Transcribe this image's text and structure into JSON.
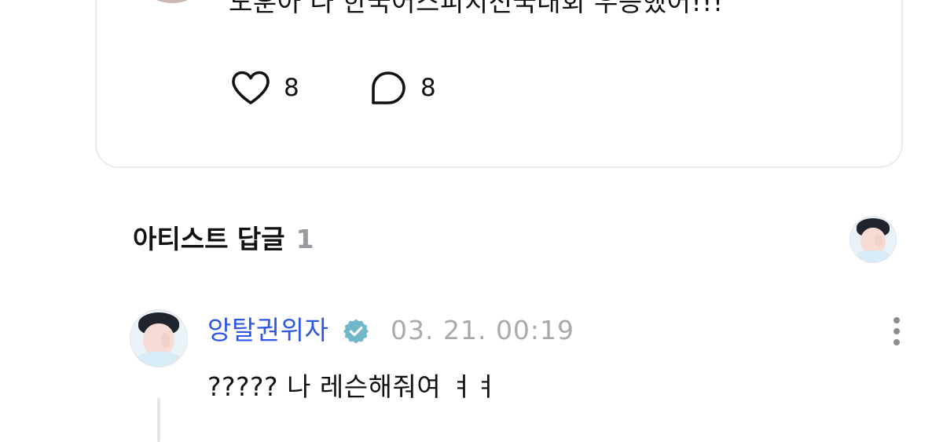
{
  "post": {
    "text": "도훈아 나 한국어스피치전국대회 우승했어!!!",
    "likes": "8",
    "comments": "8",
    "like_icon": "heart-outline-icon",
    "comment_icon": "speech-bubble-icon"
  },
  "artist_replies": {
    "title": "아티스트 답글",
    "count": "1"
  },
  "reply": {
    "author": "앙탈권위자",
    "verified_icon": "verified-badge-icon",
    "timestamp": "03. 21. 00:19",
    "text": "????? 나 레슨해줘여 ㅕㅕ",
    "more_icon": "more-vertical-icon"
  },
  "colors": {
    "author_name": "#2f57e6",
    "verified_badge": "#6fb7c9",
    "muted_text": "#a9a9ae"
  }
}
